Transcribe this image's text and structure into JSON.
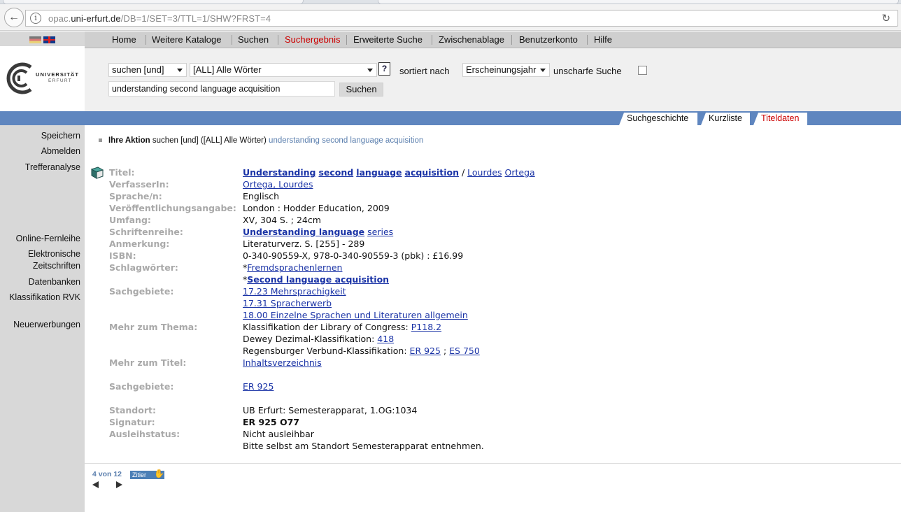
{
  "browser": {
    "url_prefix": "opac.",
    "url_domain": "uni-erfurt.de",
    "url_path": "/DB=1/SET=3/TTL=1/SHW?FRST=4"
  },
  "logo": {
    "line1": "UNIVERSITÄT",
    "line2": "ERFURT"
  },
  "topnav": [
    "Home",
    "Weitere Kataloge",
    "Suchen",
    "Suchergebnis",
    "Erweiterte Suche",
    "Zwischenablage",
    "Benutzerkonto",
    "Hilfe"
  ],
  "search": {
    "mode": "suchen [und]",
    "field": "[ALL] Alle Wörter",
    "help": "?",
    "sort_label": "sortiert nach",
    "sort_value": "Erscheinungsjahr",
    "fuzzy_label": "unscharfe Suche",
    "query": "understanding second language acquisition",
    "button": "Suchen"
  },
  "result_tabs": [
    "Suchgeschichte",
    "Kurzliste",
    "Titeldaten"
  ],
  "leftnav": {
    "group1": [
      "Speichern",
      "Abmelden",
      "Trefferanalyse"
    ],
    "group2": [
      "Online-Fernleihe",
      "Elektronische",
      "Zeitschriften",
      "Datenbanken",
      "Klassifikation RVK"
    ],
    "group3": [
      "Neuerwerbungen"
    ]
  },
  "action": {
    "label": "Ihre Aktion",
    "text": "suchen [und] ([ALL] Alle Wörter)",
    "query": "understanding second language acquisition"
  },
  "record": {
    "labels": {
      "titel": "Titel:",
      "verfasser": "VerfasserIn:",
      "sprache": "Sprache/n:",
      "veroeff": "Veröffentlichungsangabe:",
      "umfang": "Umfang:",
      "reihe": "Schriftenreihe:",
      "anmerkung": "Anmerkung:",
      "isbn": "ISBN:",
      "schlag": "Schlagwörter:",
      "sach": "Sachgebiete:",
      "mehrthema": "Mehr zum Thema:",
      "mehrtitel": "Mehr zum Titel:",
      "sach2": "Sachgebiete:",
      "standort": "Standort:",
      "signatur": "Signatur:",
      "ausleih": "Ausleihstatus:"
    },
    "title_words": [
      "Understanding",
      "second",
      "language",
      "acquisition"
    ],
    "title_sep": "/",
    "author_words": [
      "Lourdes",
      "Ortega"
    ],
    "verfasser": "Ortega, Lourdes",
    "sprache": "Englisch",
    "veroeff": "London : Hodder Education, 2009",
    "umfang": "XV, 304 S. ; 24cm",
    "reihe_bold": "Understanding language",
    "reihe_rest": "series",
    "anmerkung": "Literaturverz. S. [255] - 289",
    "isbn": "0-340-90559-X, 978-0-340-90559-3 (pbk) : £16.99",
    "schlag_star": "*",
    "schlag1": "Fremdsprachenlernen",
    "schlag2": "Second language acquisition",
    "sach": [
      "17.23 Mehrsprachigkeit",
      "17.31 Spracherwerb",
      "18.00 Einzelne Sprachen und Literaturen allgemein"
    ],
    "lcc_label": "Klassifikation der Library of Congress:",
    "lcc": "P118.2",
    "ddc_label": "Dewey Dezimal-Klassifikation:",
    "ddc": "418",
    "rvk_label": "Regensburger Verbund-Klassifikation:",
    "rvk1": "ER 925",
    "rvk_sep": ";",
    "rvk2": "ES 750",
    "mehrtitel": "Inhaltsverzeichnis",
    "sach2": "ER 925",
    "standort": "UB Erfurt: Semesterapparat, 1.OG:1034",
    "signatur": "ER 925 O77",
    "ausleih": "Nicht ausleihbar",
    "hinweis": "Bitte selbst am Standort Semesterapparat entnehmen."
  },
  "pager": {
    "text": "4 von 12",
    "zitier": "Zitier"
  }
}
